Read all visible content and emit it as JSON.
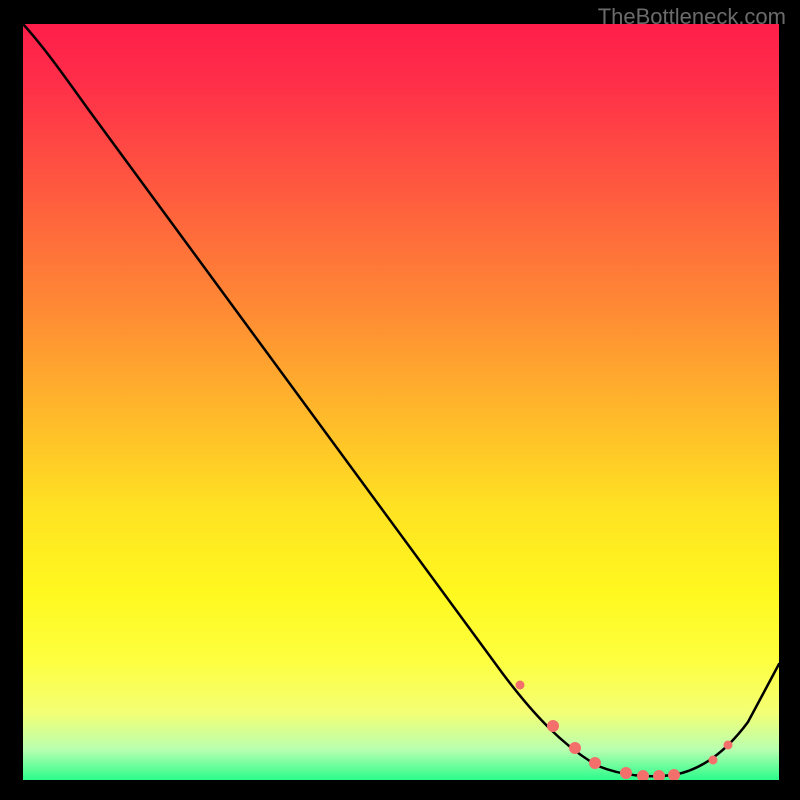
{
  "watermark": "TheBottleneck.com",
  "colors": {
    "page_bg": "#000000",
    "watermark_text": "#6b6b6b",
    "curve": "#000000",
    "dot": "#f36f6c",
    "gradient_top": "#ff1e4a",
    "gradient_bottom": "#2bfc8b"
  },
  "chart_data": {
    "type": "line",
    "title": "",
    "xlabel": "",
    "ylabel": "",
    "xlim": [
      0,
      100
    ],
    "ylim": [
      0,
      100
    ],
    "grid": false,
    "legend": false,
    "series": [
      {
        "name": "curve",
        "x": [
          0,
          4,
          10,
          20,
          30,
          40,
          50,
          60,
          68,
          72,
          76,
          80,
          84,
          88,
          92,
          96,
          100
        ],
        "y": [
          100,
          96,
          89,
          76,
          63,
          50,
          37,
          24,
          13,
          8,
          4,
          1.5,
          0.5,
          0.5,
          2,
          7,
          16
        ]
      }
    ],
    "highlight_points": {
      "name": "dots",
      "x": [
        68,
        73,
        76,
        78,
        81,
        83,
        85,
        87,
        91,
        93
      ],
      "y": [
        12,
        6,
        3,
        2,
        1,
        0.8,
        0.6,
        0.6,
        1.8,
        4
      ]
    }
  }
}
